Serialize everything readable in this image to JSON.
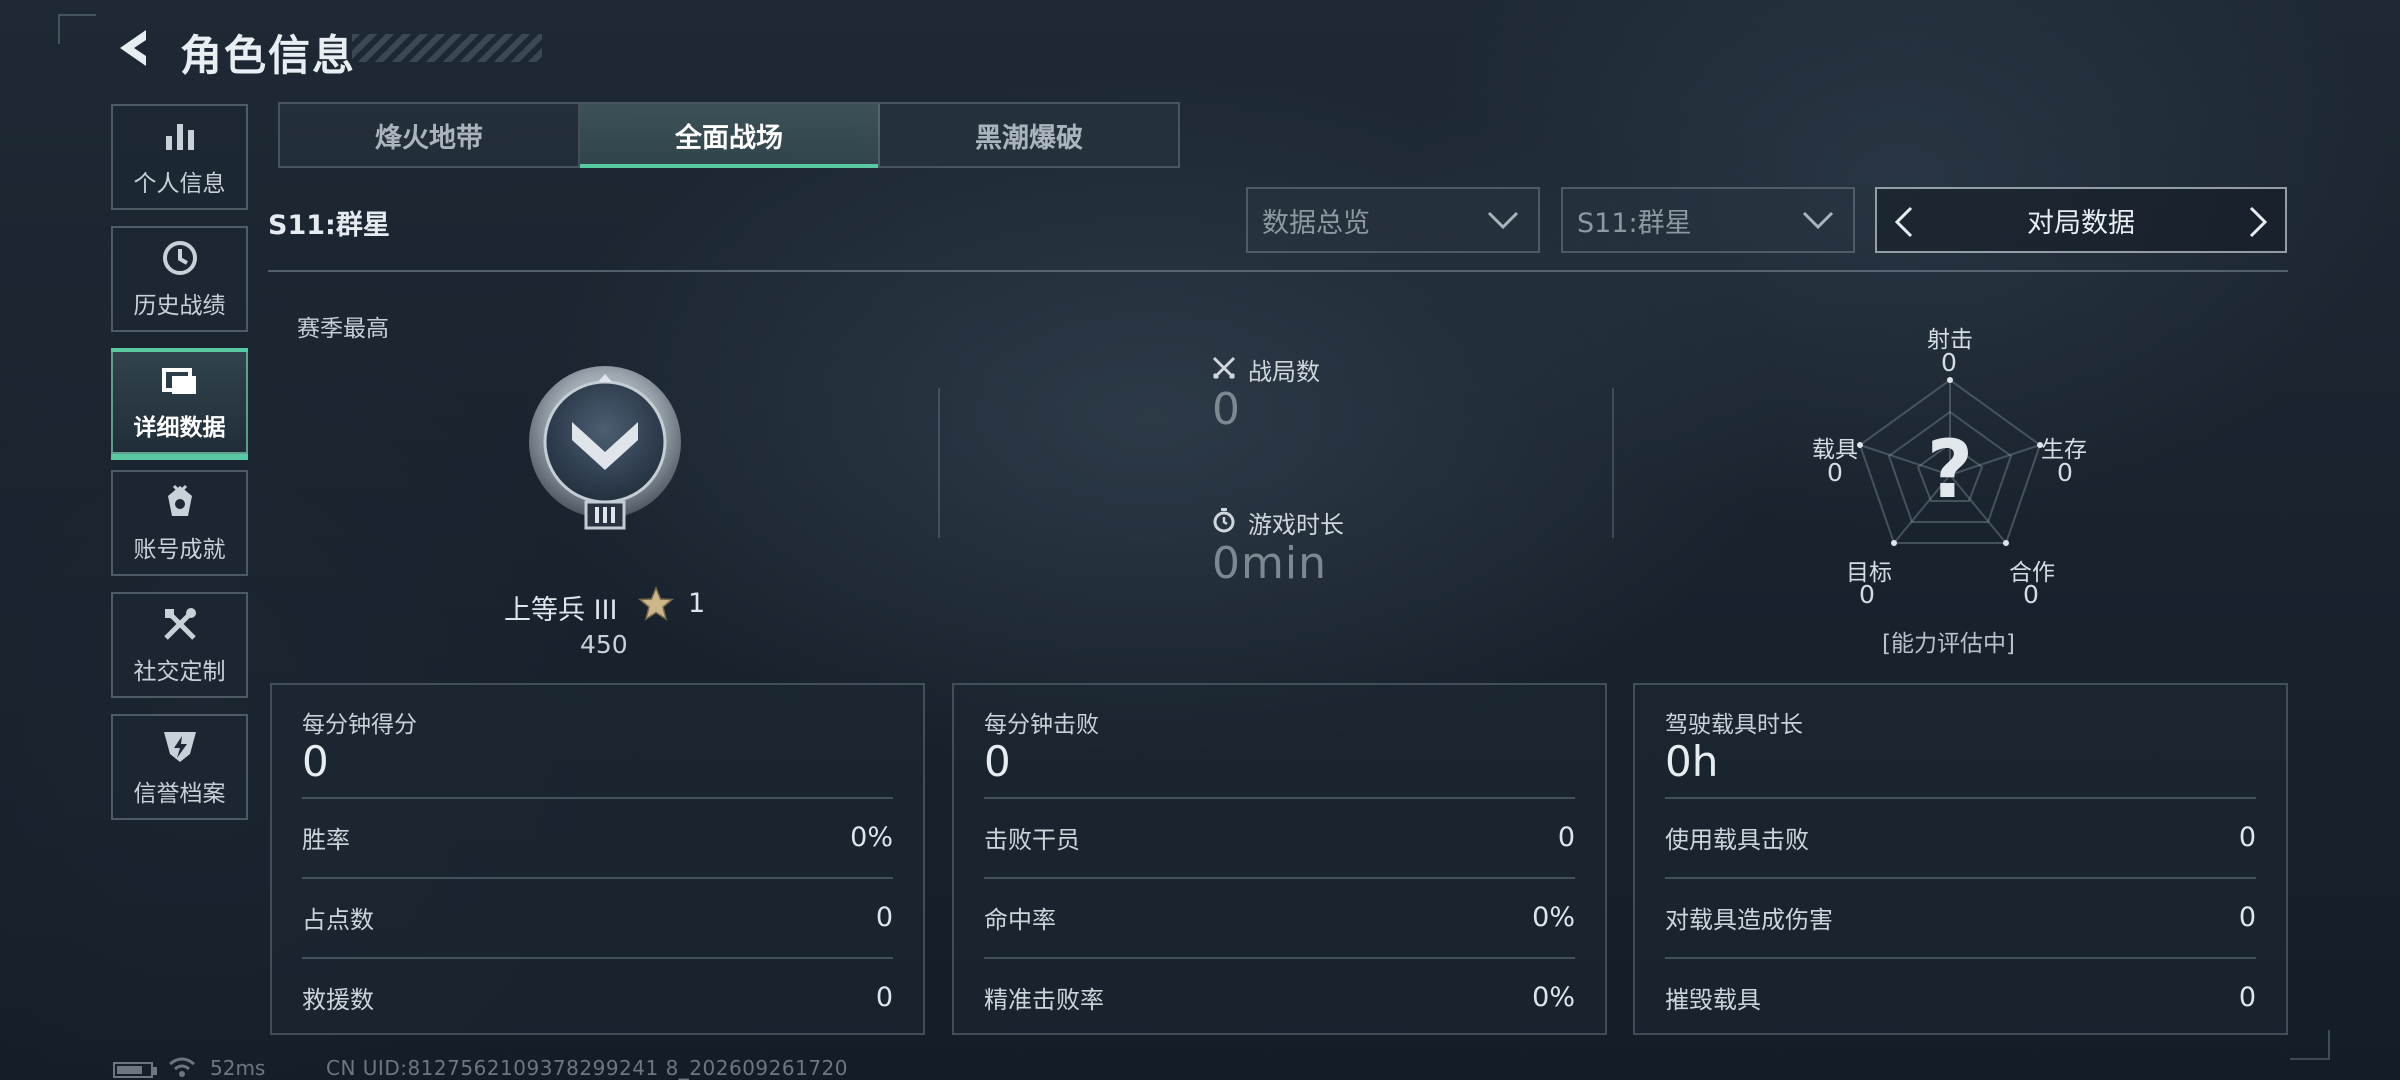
{
  "header": {
    "title": "角色信息"
  },
  "sidebar": {
    "items": [
      {
        "label": "个人信息",
        "icon": "bar-chart-icon",
        "active": false
      },
      {
        "label": "历史战绩",
        "icon": "history-icon",
        "active": false
      },
      {
        "label": "详细数据",
        "icon": "cards-icon",
        "active": true
      },
      {
        "label": "账号成就",
        "icon": "medal-icon",
        "active": false
      },
      {
        "label": "社交定制",
        "icon": "tools-icon",
        "active": false
      },
      {
        "label": "信誉档案",
        "icon": "shield-bolt-icon",
        "active": false
      }
    ]
  },
  "tabs": [
    {
      "label": "烽火地带",
      "active": false
    },
    {
      "label": "全面战场",
      "active": true
    },
    {
      "label": "黑潮爆破",
      "active": false
    }
  ],
  "season": {
    "label": "S11:群星"
  },
  "filters": {
    "overview": "数据总览",
    "season": "S11:群星",
    "mode": "对局数据"
  },
  "season_best": {
    "label": "赛季最高",
    "rank_name": "上等兵 III",
    "stars": "1",
    "points": "450"
  },
  "stats": {
    "matches_label": "战局数",
    "matches_value": "0",
    "playtime_label": "游戏时长",
    "playtime_value": "0min"
  },
  "radar": {
    "center_mark": "?",
    "status": "[能力评估中]",
    "axes": [
      {
        "label": "射击",
        "value": "0"
      },
      {
        "label": "生存",
        "value": "0"
      },
      {
        "label": "合作",
        "value": "0"
      },
      {
        "label": "目标",
        "value": "0"
      },
      {
        "label": "载具",
        "value": "0"
      }
    ]
  },
  "panels": [
    {
      "title": "每分钟得分",
      "value": "0",
      "rows": [
        {
          "label": "胜率",
          "value": "0%"
        },
        {
          "label": "占点数",
          "value": "0"
        },
        {
          "label": "救援数",
          "value": "0"
        }
      ]
    },
    {
      "title": "每分钟击败",
      "value": "0",
      "rows": [
        {
          "label": "击败干员",
          "value": "0"
        },
        {
          "label": "命中率",
          "value": "0%"
        },
        {
          "label": "精准击败率",
          "value": "0%"
        }
      ]
    },
    {
      "title": "驾驶载具时长",
      "value": "0h",
      "rows": [
        {
          "label": "使用载具击败",
          "value": "0"
        },
        {
          "label": "对载具造成伤害",
          "value": "0"
        },
        {
          "label": "摧毁载具",
          "value": "0"
        }
      ]
    }
  ],
  "footer": {
    "ping": "52ms",
    "uid": "CN UID:8127562109378299241 8_202609261720"
  },
  "colors": {
    "accent": "#58c9a0",
    "background": "#1b2530"
  }
}
